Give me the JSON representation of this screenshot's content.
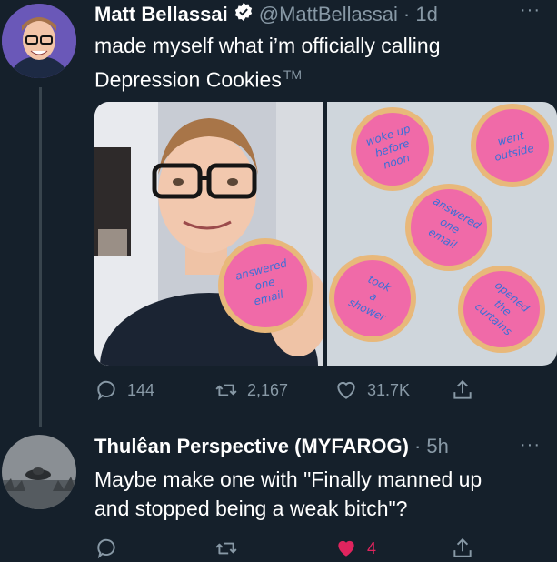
{
  "tweet": {
    "author_name": "Matt Bellassai",
    "handle": "@MattBellassai",
    "time": "· 1d",
    "text_line1": "made myself what i’m officially calling",
    "text_line2": "Depression Cookies",
    "tm": "TM",
    "more": "···",
    "actions": {
      "reply": "144",
      "retweet": "2,167",
      "like": "31.7K"
    },
    "cookies": {
      "held": [
        "answered",
        "one",
        "email"
      ],
      "c1": [
        "woke up",
        "before",
        "noon"
      ],
      "c2": [
        "went",
        "outside"
      ],
      "c3": [
        "answered",
        "one",
        "email"
      ],
      "c4": [
        "took",
        "a",
        "shower"
      ],
      "c5": [
        "opened",
        "the",
        "curtains"
      ]
    }
  },
  "reply": {
    "author_name": "Thulêan Perspective (MYFAROG)",
    "time": "· 5h",
    "more": "···",
    "text_line1": "Maybe make one with \"Finally manned up",
    "text_line2": "and stopped being a weak bitch\"?",
    "actions": {
      "like": "4"
    }
  },
  "colors": {
    "background": "#15202b",
    "muted": "#8899a6",
    "like_red": "#e0245e",
    "cookie_pink": "#f06aa8",
    "cookie_edge": "#e8b87a"
  }
}
